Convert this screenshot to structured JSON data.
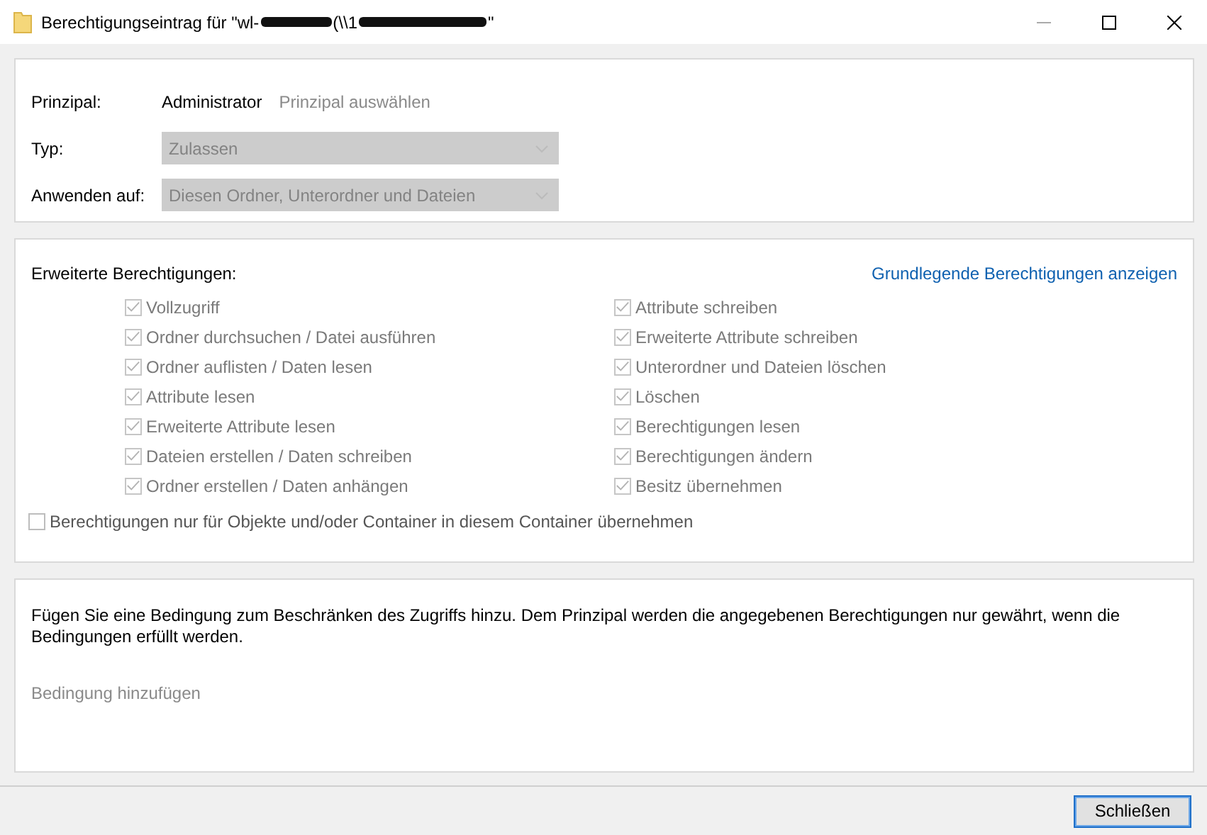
{
  "window": {
    "title_segments": [
      {
        "kind": "text",
        "text": "Berechtigungseintrag für \"wl-"
      },
      {
        "kind": "redacted"
      },
      {
        "kind": "text",
        "text": "(\\\\1"
      },
      {
        "kind": "redacted"
      },
      {
        "kind": "text",
        "text": "\""
      }
    ]
  },
  "principal": {
    "label": "Prinzipal:",
    "value": "Administrator",
    "link": "Prinzipal auswählen"
  },
  "fields": [
    {
      "label": "Typ:",
      "value": "Zulassen",
      "disabled": true
    },
    {
      "label": "Anwenden auf:",
      "value": "Diesen Ordner, Unterordner und Dateien",
      "disabled": true
    }
  ],
  "permissions": {
    "title": "Erweiterte Berechtigungen:",
    "link": "Grundlegende Berechtigungen anzeigen",
    "left": [
      {
        "label": "Vollzugriff",
        "checked": true,
        "disabled": true
      },
      {
        "label": "Ordner durchsuchen / Datei ausführen",
        "checked": true,
        "disabled": true
      },
      {
        "label": "Ordner auflisten / Daten lesen",
        "checked": true,
        "disabled": true
      },
      {
        "label": "Attribute lesen",
        "checked": true,
        "disabled": true
      },
      {
        "label": "Erweiterte Attribute lesen",
        "checked": true,
        "disabled": true
      },
      {
        "label": "Dateien erstellen / Daten schreiben",
        "checked": true,
        "disabled": true
      },
      {
        "label": "Ordner erstellen / Daten anhängen",
        "checked": true,
        "disabled": true
      }
    ],
    "right": [
      {
        "label": "Attribute schreiben",
        "checked": true,
        "disabled": true
      },
      {
        "label": "Erweiterte Attribute schreiben",
        "checked": true,
        "disabled": true
      },
      {
        "label": "Unterordner und Dateien löschen",
        "checked": true,
        "disabled": true
      },
      {
        "label": "Löschen",
        "checked": true,
        "disabled": true
      },
      {
        "label": "Berechtigungen lesen",
        "checked": true,
        "disabled": true
      },
      {
        "label": "Berechtigungen ändern",
        "checked": true,
        "disabled": true
      },
      {
        "label": "Besitz übernehmen",
        "checked": true,
        "disabled": true
      }
    ],
    "inherit": {
      "label": "Berechtigungen nur für Objekte und/oder Container in diesem Container übernehmen",
      "checked": false,
      "disabled": false
    }
  },
  "condition": {
    "text": "Fügen Sie eine Bedingung zum Beschränken des Zugriffs hinzu. Dem Prinzipal werden die angegebenen Berechtigungen nur gewährt, wenn die Bedingungen erfüllt werden.",
    "link": "Bedingung hinzufügen"
  },
  "buttons": [
    "Schließen"
  ]
}
